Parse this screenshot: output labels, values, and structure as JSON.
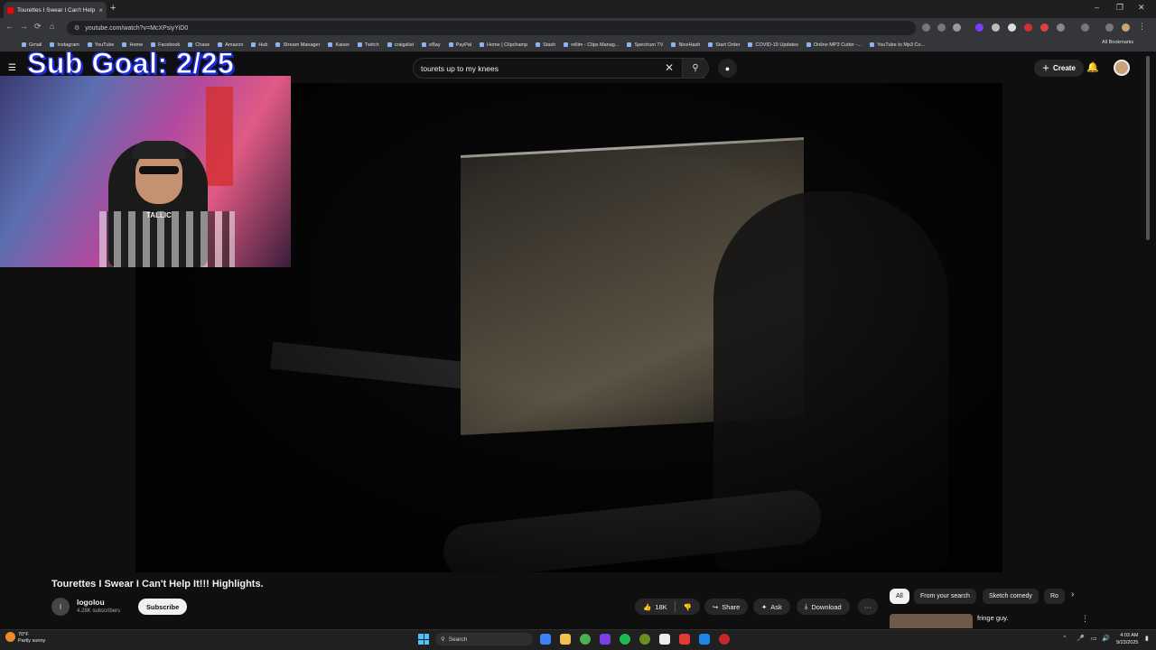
{
  "browser": {
    "tab_title": "Tourettes I Swear I Can't Help",
    "url": "youtube.com/watch?v=McXPsiyYiD0",
    "new_tab": "+",
    "close_tab": "×",
    "bookmarks": [
      "Gmail",
      "Instagram",
      "YouTube",
      "Home",
      "Facebook",
      "Chase",
      "Amazon",
      "Hub",
      "Stream Manager",
      "Kaiser",
      "Twitch",
      "craigslist",
      "eBay",
      "PayPal",
      "Home | Clipchamp",
      "Stash",
      "rellim - Clips Manag...",
      "Spectrum TV",
      "NiceHash",
      "Start Order",
      "COVID-19 Updates",
      "Online MP3 Cutter -...",
      "YouTube to Mp3 Co..."
    ],
    "all_bookmarks": "All Bookmarks"
  },
  "youtube": {
    "search_query": "tourets up to my knees",
    "create_label": "Create"
  },
  "overlay": {
    "sub_goal": "Sub Goal: 2/25",
    "shirt_text": "TALLIC"
  },
  "video": {
    "title": "Tourettes I Swear I Can't Help It!!! Highlights.",
    "channel_initial": "l",
    "channel": "logolou",
    "subscribers": "4.28K subscribers",
    "subscribe_label": "Subscribe",
    "likes": "18K",
    "share_label": "Share",
    "ask_label": "Ask",
    "download_label": "Download",
    "more_label": "···"
  },
  "chips": [
    "All",
    "From your search",
    "Sketch comedy",
    "Ro"
  ],
  "recommendation": {
    "title": "fringe guy."
  },
  "taskbar": {
    "temperature": "70°F",
    "weather": "Partly sunny",
    "search_label": "Search",
    "time": "4:03 AM",
    "date": "9/23/2025"
  },
  "colors": {
    "youtube_bg": "#0f0f0f",
    "overlay_stroke": "#1c2bd6",
    "accent_red": "#ff0000"
  }
}
